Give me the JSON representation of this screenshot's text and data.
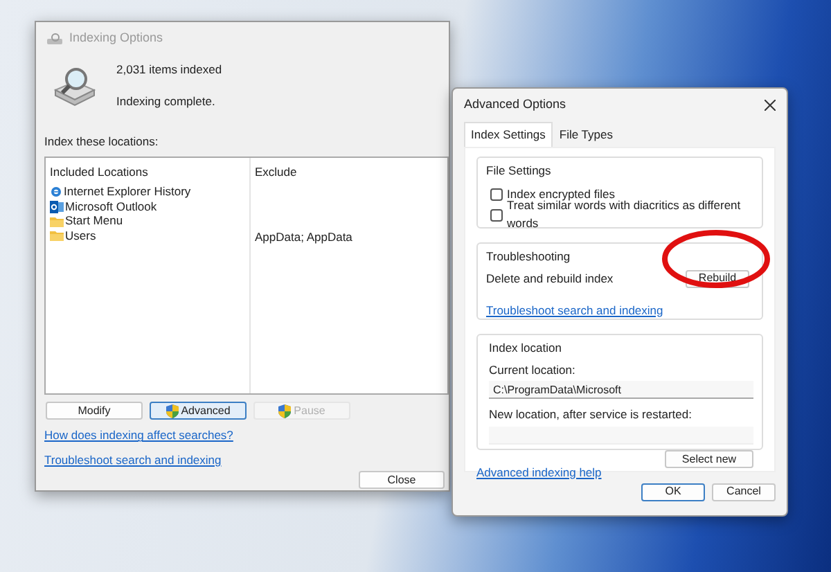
{
  "main_window": {
    "title": "Indexing Options",
    "items_count": "2,031 items indexed",
    "status": "Indexing complete.",
    "locations_label": "Index these locations:",
    "columns": [
      "Included Locations",
      "Exclude"
    ],
    "rows": [
      {
        "kind": "ie",
        "location": "Internet Explorer History",
        "exclude": ""
      },
      {
        "kind": "outlook",
        "location": "Microsoft Outlook",
        "exclude": ""
      },
      {
        "kind": "folder",
        "location": "Start Menu",
        "exclude": ""
      },
      {
        "kind": "folder",
        "location": "Users",
        "exclude": "AppData; AppData"
      }
    ],
    "buttons": [
      {
        "label": "Modify",
        "shield": false,
        "focused": false,
        "disabled": false
      },
      {
        "label": "Advanced",
        "shield": true,
        "focused": true,
        "disabled": false
      },
      {
        "label": "Pause",
        "shield": true,
        "focused": false,
        "disabled": true
      }
    ],
    "links": [
      "How does indexing affect searches?",
      "Troubleshoot search and indexing"
    ],
    "close_button": "Close"
  },
  "advanced_dialog": {
    "title": "Advanced Options",
    "tabs": [
      {
        "label": "Index Settings",
        "selected": true
      },
      {
        "label": "File Types",
        "selected": false
      }
    ],
    "file_settings": {
      "title": "File Settings",
      "checkboxes": [
        {
          "label": "Index encrypted files",
          "checked": false
        },
        {
          "label": "Treat similar words with diacritics as different words",
          "checked": false
        }
      ]
    },
    "troubleshooting": {
      "title": "Troubleshooting",
      "text": "Delete and rebuild index",
      "button": "Rebuild",
      "link": "Troubleshoot search and indexing"
    },
    "index_location": {
      "title": "Index location",
      "current_label": "Current location:",
      "current_value": "C:\\ProgramData\\Microsoft",
      "new_label": "New location, after service is restarted:",
      "button": "Select new"
    },
    "help_link": "Advanced indexing help",
    "buttons": [
      {
        "label": "OK",
        "focused": true
      },
      {
        "label": "Cancel",
        "focused": false
      }
    ]
  }
}
